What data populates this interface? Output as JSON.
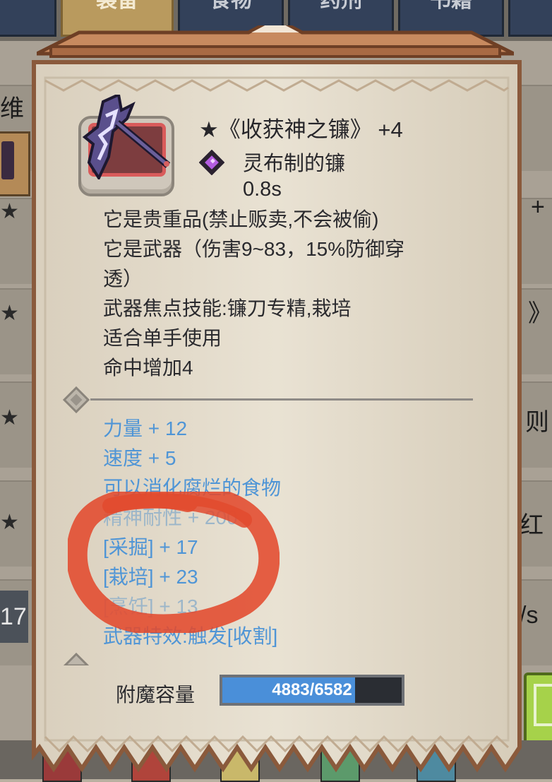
{
  "tabs": [
    {
      "label": "装备",
      "active": true
    },
    {
      "label": "食物",
      "active": false
    },
    {
      "label": "药剂",
      "active": false
    },
    {
      "label": "书籍",
      "active": false
    }
  ],
  "background": {
    "left_text_1": "维",
    "star": "★",
    "right_text_1": "+",
    "right_text_2": "》",
    "right_text_3": "则",
    "right_text_4": "红",
    "left_number": "17",
    "right_unit": "/s"
  },
  "item": {
    "title": "★《收获神之镰》 +4",
    "material": "灵布制的镰",
    "speed": "0.8s",
    "icon": "scythe-icon",
    "gem_icon": "purple-gem-icon"
  },
  "description": [
    "它是贵重品(禁止贩卖,不会被偷)",
    "它是武器（伤害9~83，15%防御穿",
    "透）",
    "武器焦点技能:镰刀专精,栽培",
    "适合单手使用",
    "命中增加4"
  ],
  "stats": [
    "力量 + 12",
    "速度 + 5",
    "可以消化腐烂的食物",
    "精神耐性 + 200",
    "[采掘] + 17",
    "[栽培] + 23",
    "[烹饪] + 13",
    "武器特效:触发[收割]"
  ],
  "enchant": {
    "label": "附魔容量",
    "value_text": "4883/6582",
    "current": 4883,
    "max": 6582
  },
  "colors": {
    "stat_blue": "#4f95d6",
    "scribble_red": "#e24a2e",
    "parchment": "#e4dccc",
    "bar_fill": "#4a8fd9"
  }
}
